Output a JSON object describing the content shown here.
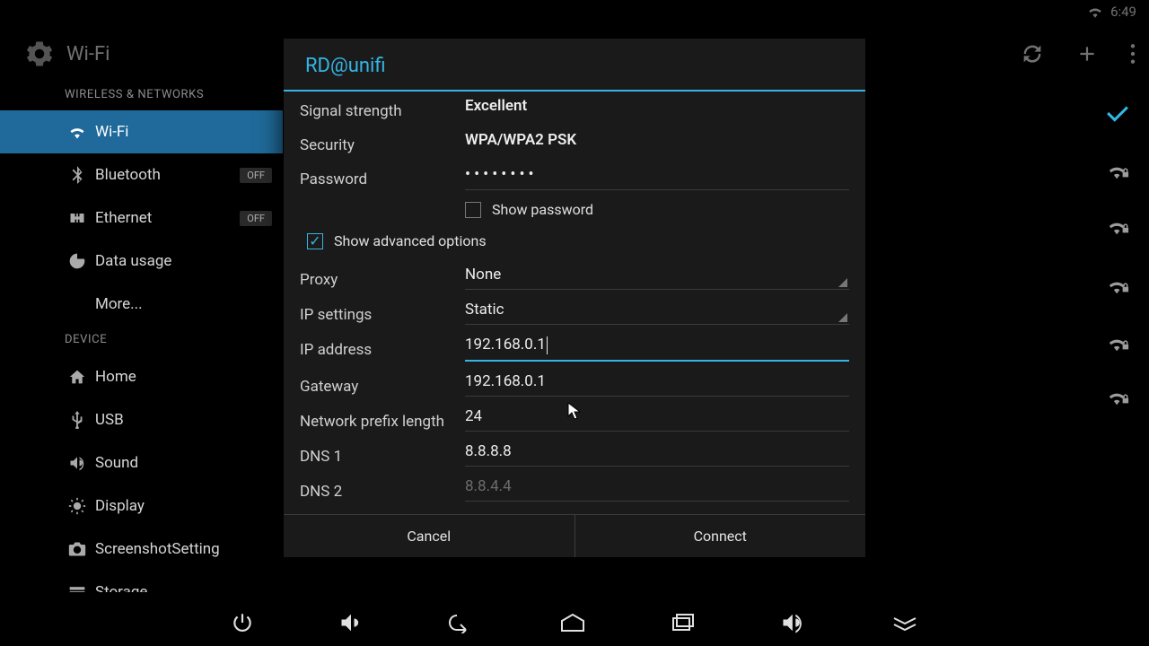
{
  "statusbar": {
    "time": "6:49"
  },
  "header": {
    "title": "Wi-Fi"
  },
  "sidebar": {
    "wireless_head": "WIRELESS & NETWORKS",
    "device_head": "DEVICE",
    "items": {
      "wifi": "Wi-Fi",
      "bluetooth": "Bluetooth",
      "ethernet": "Ethernet",
      "data_usage": "Data usage",
      "more": "More...",
      "home": "Home",
      "usb": "USB",
      "sound": "Sound",
      "display": "Display",
      "screenshot": "ScreenshotSetting",
      "storage": "Storage"
    },
    "off_badge": "OFF"
  },
  "dialog": {
    "title": "RD@unifi",
    "signal_strength_label": "Signal strength",
    "signal_strength_value": "Excellent",
    "security_label": "Security",
    "security_value": "WPA/WPA2 PSK",
    "password_label": "Password",
    "password_value": "••••••••",
    "show_password": "Show password",
    "show_advanced": "Show advanced options",
    "proxy_label": "Proxy",
    "proxy_value": "None",
    "ip_settings_label": "IP settings",
    "ip_settings_value": "Static",
    "ip_address_label": "IP address",
    "ip_address_value": "192.168.0.1",
    "gateway_label": "Gateway",
    "gateway_value": "192.168.0.1",
    "prefix_label": "Network prefix length",
    "prefix_value": "24",
    "dns1_label": "DNS 1",
    "dns1_value": "8.8.8.8",
    "dns2_label": "DNS 2",
    "dns2_placeholder": "8.8.4.4",
    "cancel": "Cancel",
    "connect": "Connect"
  }
}
